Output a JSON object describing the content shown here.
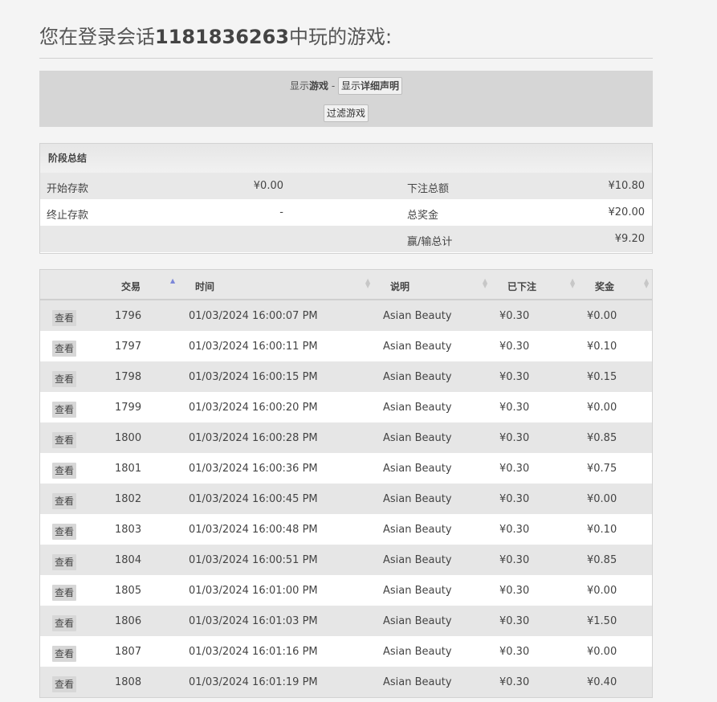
{
  "heading": {
    "prefix": "您在登录会话",
    "session_id": "1181836263",
    "suffix": "中玩的游戏:"
  },
  "filter": {
    "show_games_prefix": "显示",
    "show_games_bold": "游戏",
    "separator": " - ",
    "details_button_prefix": "显示",
    "details_button_bold": "详细声明",
    "filter_button": "过滤游戏"
  },
  "summary": {
    "title": "阶段总结",
    "opening_balance_label": "开始存款",
    "opening_balance_value": "¥0.00",
    "closing_balance_label": "终止存款",
    "closing_balance_value": "-",
    "total_bet_label": "下注总额",
    "total_bet_value": "¥10.80",
    "total_win_label": "总奖金",
    "total_win_value": "¥20.00",
    "net_label": "赢/输总计",
    "net_value": "¥9.20"
  },
  "table": {
    "columns": [
      "交易",
      "时间",
      "说明",
      "已下注",
      "奖金"
    ],
    "view_label": "查看",
    "rows": [
      {
        "id": "1796",
        "time": "01/03/2024 16:00:07 PM",
        "desc": "Asian Beauty",
        "bet": "¥0.30",
        "win": "¥0.00"
      },
      {
        "id": "1797",
        "time": "01/03/2024 16:00:11 PM",
        "desc": "Asian Beauty",
        "bet": "¥0.30",
        "win": "¥0.10"
      },
      {
        "id": "1798",
        "time": "01/03/2024 16:00:15 PM",
        "desc": "Asian Beauty",
        "bet": "¥0.30",
        "win": "¥0.15"
      },
      {
        "id": "1799",
        "time": "01/03/2024 16:00:20 PM",
        "desc": "Asian Beauty",
        "bet": "¥0.30",
        "win": "¥0.00"
      },
      {
        "id": "1800",
        "time": "01/03/2024 16:00:28 PM",
        "desc": "Asian Beauty",
        "bet": "¥0.30",
        "win": "¥0.85"
      },
      {
        "id": "1801",
        "time": "01/03/2024 16:00:36 PM",
        "desc": "Asian Beauty",
        "bet": "¥0.30",
        "win": "¥0.75"
      },
      {
        "id": "1802",
        "time": "01/03/2024 16:00:45 PM",
        "desc": "Asian Beauty",
        "bet": "¥0.30",
        "win": "¥0.00"
      },
      {
        "id": "1803",
        "time": "01/03/2024 16:00:48 PM",
        "desc": "Asian Beauty",
        "bet": "¥0.30",
        "win": "¥0.10"
      },
      {
        "id": "1804",
        "time": "01/03/2024 16:00:51 PM",
        "desc": "Asian Beauty",
        "bet": "¥0.30",
        "win": "¥0.85"
      },
      {
        "id": "1805",
        "time": "01/03/2024 16:01:00 PM",
        "desc": "Asian Beauty",
        "bet": "¥0.30",
        "win": "¥0.00"
      },
      {
        "id": "1806",
        "time": "01/03/2024 16:01:03 PM",
        "desc": "Asian Beauty",
        "bet": "¥0.30",
        "win": "¥1.50"
      },
      {
        "id": "1807",
        "time": "01/03/2024 16:01:16 PM",
        "desc": "Asian Beauty",
        "bet": "¥0.30",
        "win": "¥0.00"
      },
      {
        "id": "1808",
        "time": "01/03/2024 16:01:19 PM",
        "desc": "Asian Beauty",
        "bet": "¥0.30",
        "win": "¥0.40"
      }
    ]
  },
  "colors": {
    "sort_active": "#7b86d8",
    "row_alt": "#e6e6e6",
    "header_bg": "#d6d6d6"
  },
  "icons": {
    "sort_asc": "triangle-up",
    "sort_both": "up-down-arrows"
  }
}
